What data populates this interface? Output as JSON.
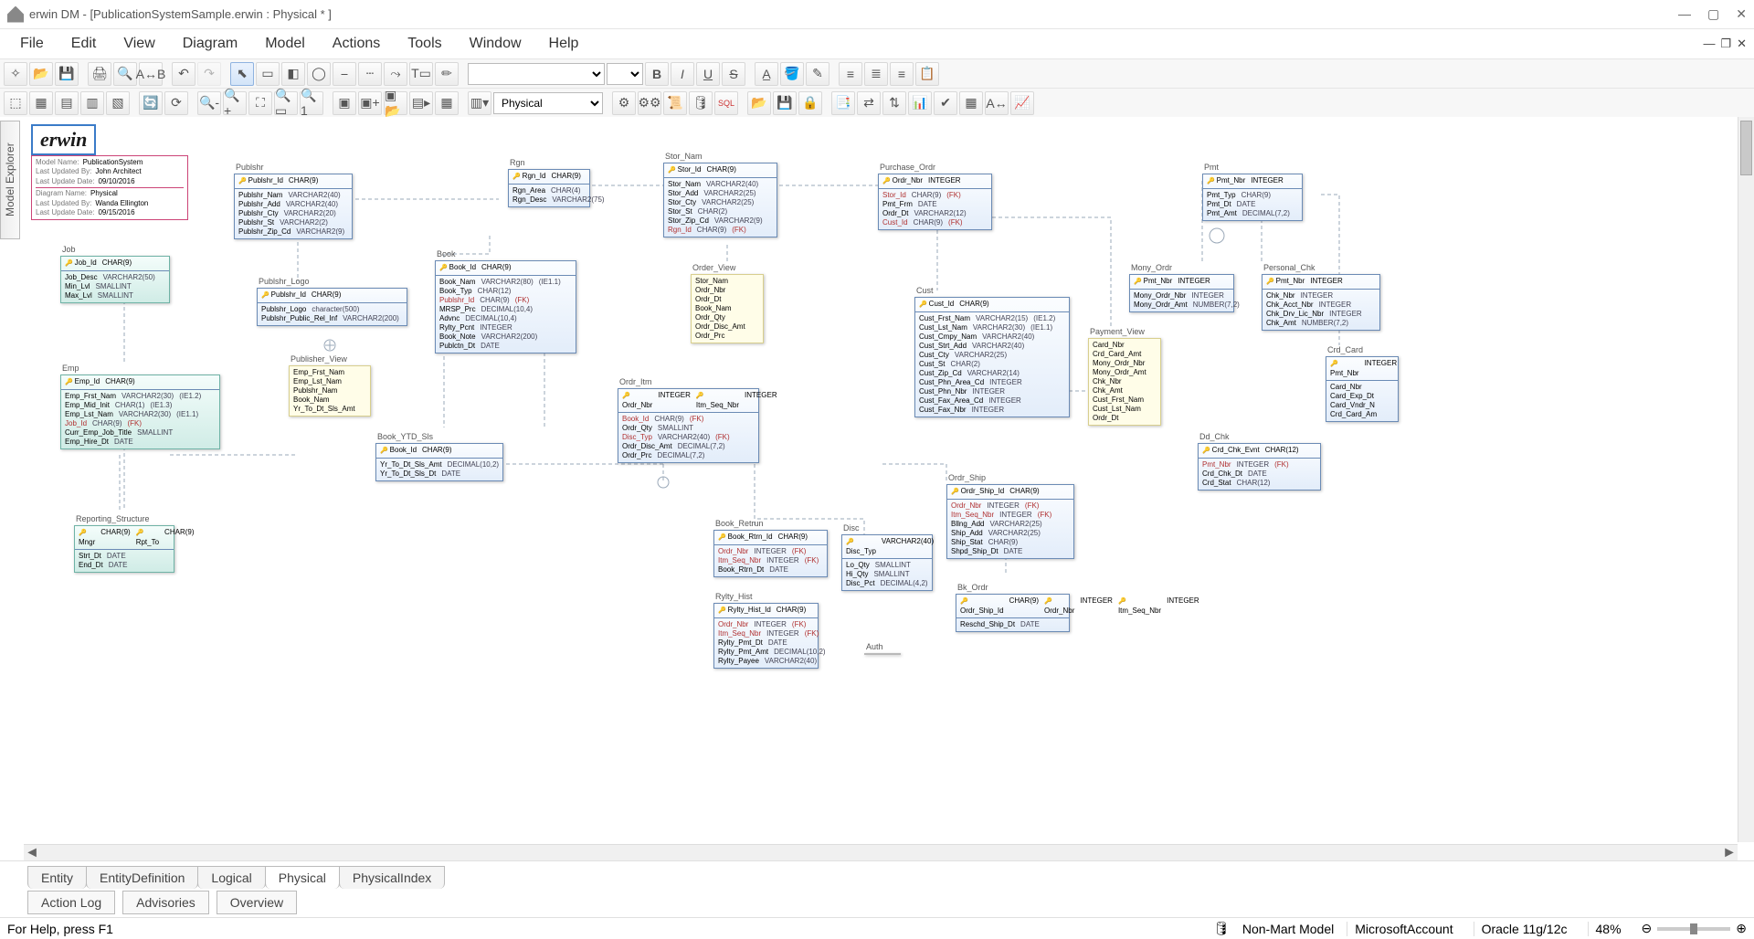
{
  "app_title": "erwin DM - [PublicationSystemSample.erwin : Physical * ]",
  "menus": [
    "File",
    "Edit",
    "View",
    "Diagram",
    "Model",
    "Actions",
    "Tools",
    "Window",
    "Help"
  ],
  "view_combo": "Physical",
  "side_panel": "Model Explorer",
  "diagram_tabs": [
    "Entity",
    "EntityDefinition",
    "Logical",
    "Physical",
    "PhysicalIndex"
  ],
  "active_diagram_tab": 3,
  "bottom_tabs": [
    "Action Log",
    "Advisories",
    "Overview"
  ],
  "status": {
    "help": "For Help, press F1",
    "mart": "Non-Mart Model",
    "account": "MicrosoftAccount",
    "db": "Oracle 11g/12c",
    "zoom": "48%"
  },
  "logo_text": "erwin",
  "meta_box": [
    [
      "Model Name:",
      "PublicationSystem"
    ],
    [
      "Last Updated By:",
      "John Architect"
    ],
    [
      "Last Update Date:",
      "09/10/2016"
    ],
    [
      "Diagram Name:",
      "Physical"
    ],
    [
      "Last Updated By:",
      "Wanda Ellington"
    ],
    [
      "Last Update Date:",
      "09/15/2016"
    ]
  ],
  "entities": {
    "Publshr": {
      "cap": "Publshr",
      "pk": [
        [
          "Publshr_Id",
          "CHAR(9)"
        ]
      ],
      "cols": [
        [
          "Publshr_Nam",
          "VARCHAR2(40)"
        ],
        [
          "Publshr_Add",
          "VARCHAR2(40)"
        ],
        [
          "Publshr_Cty",
          "VARCHAR2(20)"
        ],
        [
          "Publshr_St",
          "VARCHAR2(2)"
        ],
        [
          "Publshr_Zip_Cd",
          "VARCHAR2(9)"
        ]
      ]
    },
    "Rgn": {
      "cap": "Rgn",
      "pk": [
        [
          "Rgn_Id",
          "CHAR(9)"
        ]
      ],
      "cols": [
        [
          "Rgn_Area",
          "CHAR(4)"
        ],
        [
          "Rgn_Desc",
          "VARCHAR2(75)"
        ]
      ]
    },
    "Stor_Nam": {
      "cap": "Stor_Nam",
      "pk": [
        [
          "Stor_Id",
          "CHAR(9)"
        ]
      ],
      "cols": [
        [
          "Stor_Nam",
          "VARCHAR2(40)"
        ],
        [
          "Stor_Add",
          "VARCHAR2(25)"
        ],
        [
          "Stor_Cty",
          "VARCHAR2(25)"
        ],
        [
          "Stor_St",
          "CHAR(2)"
        ],
        [
          "Stor_Zip_Cd",
          "VARCHAR2(9)"
        ],
        [
          "Rgn_Id",
          "CHAR(9)",
          "fk"
        ]
      ]
    },
    "Purchase_Ordr": {
      "cap": "Purchase_Ordr",
      "pk": [
        [
          "Ordr_Nbr",
          "INTEGER"
        ]
      ],
      "cols": [
        [
          "Stor_Id",
          "CHAR(9)",
          "fk"
        ],
        [
          "Pmt_Frm",
          "DATE"
        ],
        [
          "Ordr_Dt",
          "VARCHAR2(12)"
        ],
        [
          "Cust_Id",
          "CHAR(9)",
          "fk"
        ]
      ]
    },
    "Pmt": {
      "cap": "Pmt",
      "pk": [
        [
          "Pmt_Nbr",
          "INTEGER"
        ]
      ],
      "cols": [
        [
          "Pmt_Typ",
          "CHAR(9)"
        ],
        [
          "Pmt_Dt",
          "DATE"
        ],
        [
          "Pmt_Amt",
          "DECIMAL(7,2)"
        ]
      ]
    },
    "Job": {
      "cap": "Job",
      "pk": [
        [
          "Job_Id",
          "CHAR(9)"
        ]
      ],
      "cols": [
        [
          "Job_Desc",
          "VARCHAR2(50)"
        ],
        [
          "Min_Lvl",
          "SMALLINT"
        ],
        [
          "Max_Lvl",
          "SMALLINT"
        ]
      ]
    },
    "Publshr_Logo": {
      "cap": "Publshr_Logo",
      "pk": [
        [
          "Publshr_Id",
          "CHAR(9)",
          "fk"
        ]
      ],
      "cols": [
        [
          "Publshr_Logo",
          "character(500)"
        ],
        [
          "Publshr_Public_Rel_Inf",
          "VARCHAR2(200)"
        ]
      ]
    },
    "Book": {
      "cap": "Book",
      "pk": [
        [
          "Book_Id",
          "CHAR(9)"
        ]
      ],
      "cols": [
        [
          "Book_Nam",
          "VARCHAR2(80)",
          "",
          "(IE1.1)"
        ],
        [
          "Book_Typ",
          "CHAR(12)"
        ],
        [
          "Publshr_Id",
          "CHAR(9)",
          "fk"
        ],
        [
          "MRSP_Prc",
          "DECIMAL(10,4)"
        ],
        [
          "Advnc",
          "DECIMAL(10,4)"
        ],
        [
          "Rylty_Pcnt",
          "INTEGER"
        ],
        [
          "Book_Note",
          "VARCHAR2(200)"
        ],
        [
          "Publctn_Dt",
          "DATE"
        ]
      ]
    },
    "Order_View": {
      "cap": "Order_View",
      "cols": [
        [
          "Stor_Nam"
        ],
        [
          "Ordr_Nbr"
        ],
        [
          "Ordr_Dt"
        ],
        [
          "Book_Nam"
        ],
        [
          "Ordr_Qty"
        ],
        [
          "Ordr_Disc_Amt"
        ],
        [
          "Ordr_Prc"
        ]
      ]
    },
    "Mony_Ordr": {
      "cap": "Mony_Ordr",
      "pk": [
        [
          "Pmt_Nbr",
          "INTEGER",
          "fk"
        ]
      ],
      "cols": [
        [
          "Mony_Ordr_Nbr",
          "INTEGER"
        ],
        [
          "Mony_Ordr_Amt",
          "NUMBER(7,2)"
        ]
      ]
    },
    "Personal_Chk": {
      "cap": "Personal_Chk",
      "pk": [
        [
          "Pmt_Nbr",
          "INTEGER",
          "fk"
        ]
      ],
      "cols": [
        [
          "Chk_Nbr",
          "INTEGER"
        ],
        [
          "Chk_Acct_Nbr",
          "INTEGER"
        ],
        [
          "Chk_Drv_Lic_Nbr",
          "INTEGER"
        ],
        [
          "Chk_Amt",
          "NUMBER(7,2)"
        ]
      ]
    },
    "Cust": {
      "cap": "Cust",
      "pk": [
        [
          "Cust_Id",
          "CHAR(9)"
        ]
      ],
      "cols": [
        [
          "Cust_Frst_Nam",
          "VARCHAR2(15)",
          "",
          "(IE1.2)"
        ],
        [
          "Cust_Lst_Nam",
          "VARCHAR2(30)",
          "",
          "(IE1.1)"
        ],
        [
          "Cust_Cmpy_Nam",
          "VARCHAR2(40)"
        ],
        [
          "Cust_Strt_Add",
          "VARCHAR2(40)"
        ],
        [
          "Cust_Cty",
          "VARCHAR2(25)"
        ],
        [
          "Cust_St",
          "CHAR(2)"
        ],
        [
          "Cust_Zip_Cd",
          "VARCHAR2(14)"
        ],
        [
          "Cust_Phn_Area_Cd",
          "INTEGER"
        ],
        [
          "Cust_Phn_Nbr",
          "INTEGER"
        ],
        [
          "Cust_Fax_Area_Cd",
          "INTEGER"
        ],
        [
          "Cust_Fax_Nbr",
          "INTEGER"
        ]
      ]
    },
    "Emp": {
      "cap": "Emp",
      "pk": [
        [
          "Emp_Id",
          "CHAR(9)"
        ]
      ],
      "cols": [
        [
          "Emp_Frst_Nam",
          "VARCHAR2(30)",
          "",
          "(IE1.2)"
        ],
        [
          "Emp_Mid_Init",
          "CHAR(1)",
          "",
          "(IE1.3)"
        ],
        [
          "Emp_Lst_Nam",
          "VARCHAR2(30)",
          "",
          "(IE1.1)"
        ],
        [
          "Job_Id",
          "CHAR(9)",
          "fk"
        ],
        [
          "Curr_Emp_Job_Title",
          "SMALLINT"
        ],
        [
          "Emp_Hire_Dt",
          "DATE"
        ]
      ]
    },
    "Publisher_View": {
      "cap": "Publisher_View",
      "cols": [
        [
          "Emp_Frst_Nam"
        ],
        [
          "Emp_Lst_Nam"
        ],
        [
          "Publshr_Nam"
        ],
        [
          "Book_Nam"
        ],
        [
          "Yr_To_Dt_Sls_Amt"
        ]
      ]
    },
    "Payment_View": {
      "cap": "Payment_View",
      "cols": [
        [
          "Card_Nbr"
        ],
        [
          "Crd_Card_Amt"
        ],
        [
          "Mony_Ordr_Nbr"
        ],
        [
          "Mony_Ordr_Amt"
        ],
        [
          "Chk_Nbr"
        ],
        [
          "Chk_Amt"
        ],
        [
          "Cust_Frst_Nam"
        ],
        [
          "Cust_Lst_Nam"
        ],
        [
          "Ordr_Dt"
        ]
      ]
    },
    "Book_YTD_Sls": {
      "cap": "Book_YTD_Sls",
      "pk": [
        [
          "Book_Id",
          "CHAR(9)",
          "fk"
        ]
      ],
      "cols": [
        [
          "Yr_To_Dt_Sls_Amt",
          "DECIMAL(10,2)"
        ],
        [
          "Yr_To_Dt_Sls_Dt",
          "DATE"
        ]
      ]
    },
    "Ordr_Itm": {
      "cap": "Ordr_Itm",
      "pk": [
        [
          "Ordr_Nbr",
          "INTEGER",
          "fk"
        ],
        [
          "Itm_Seq_Nbr",
          "INTEGER"
        ]
      ],
      "cols": [
        [
          "Book_Id",
          "CHAR(9)",
          "fk"
        ],
        [
          "Ordr_Qty",
          "SMALLINT"
        ],
        [
          "Disc_Typ",
          "VARCHAR2(40)",
          "fk"
        ],
        [
          "Ordr_Disc_Amt",
          "DECIMAL(7,2)"
        ],
        [
          "Ordr_Prc",
          "DECIMAL(7,2)"
        ]
      ]
    },
    "Ordr_Ship": {
      "cap": "Ordr_Ship",
      "pk": [
        [
          "Ordr_Ship_Id",
          "CHAR(9)"
        ]
      ],
      "cols": [
        [
          "Ordr_Nbr",
          "INTEGER",
          "fk"
        ],
        [
          "Itm_Seq_Nbr",
          "INTEGER",
          "fk"
        ],
        [
          "Bllng_Add",
          "VARCHAR2(25)"
        ],
        [
          "Ship_Add",
          "VARCHAR2(25)"
        ],
        [
          "Ship_Stat",
          "CHAR(9)"
        ],
        [
          "Shpd_Ship_Dt",
          "DATE"
        ]
      ]
    },
    "Reporting_Structure": {
      "cap": "Reporting_Structure",
      "pk": [
        [
          "Mngr",
          "CHAR(9)",
          "fk"
        ],
        [
          "Rpt_To",
          "CHAR(9)",
          "fk"
        ]
      ],
      "cols": [
        [
          "Strt_Dt",
          "DATE"
        ],
        [
          "End_Dt",
          "DATE"
        ]
      ]
    },
    "Book_Retrun": {
      "cap": "Book_Retrun",
      "pk": [
        [
          "Book_Rtrn_Id",
          "CHAR(9)"
        ]
      ],
      "cols": [
        [
          "Ordr_Nbr",
          "INTEGER",
          "fk"
        ],
        [
          "Itm_Seq_Nbr",
          "INTEGER",
          "fk"
        ],
        [
          "Book_Rtrn_Dt",
          "DATE"
        ]
      ]
    },
    "Disc": {
      "cap": "Disc",
      "pk": [
        [
          "Disc_Typ",
          "VARCHAR2(40)"
        ]
      ],
      "cols": [
        [
          "Lo_Qty",
          "SMALLINT"
        ],
        [
          "Hi_Qty",
          "SMALLINT"
        ],
        [
          "Disc_Pct",
          "DECIMAL(4,2)"
        ]
      ]
    },
    "Bk_Ordr": {
      "cap": "Bk_Ordr",
      "pk": [
        [
          "Ordr_Ship_Id",
          "CHAR(9)",
          "fk"
        ],
        [
          "Ordr_Nbr",
          "INTEGER",
          "fk"
        ],
        [
          "Itm_Seq_Nbr",
          "INTEGER",
          "fk"
        ]
      ],
      "cols": [
        [
          "Reschd_Ship_Dt",
          "DATE"
        ]
      ]
    },
    "Crd_Card": {
      "cap": "Crd_Card",
      "pk": [
        [
          "Pmt_Nbr",
          "INTEGER",
          "fk"
        ]
      ],
      "cols": [
        [
          "Card_Nbr"
        ],
        [
          "Card_Exp_Dt"
        ],
        [
          "Card_Vndr_N"
        ],
        [
          "Crd_Card_Am"
        ]
      ]
    },
    "Dd_Chk": {
      "cap": "Dd_Chk",
      "pk": [
        [
          "Crd_Chk_Evnt",
          "CHAR(12)"
        ]
      ],
      "cols": [
        [
          "Pmt_Nbr",
          "INTEGER",
          "fk"
        ],
        [
          "Crd_Chk_Dt",
          "DATE"
        ],
        [
          "Crd_Stat",
          "CHAR(12)"
        ]
      ]
    },
    "Rylty_Hist": {
      "cap": "Rylty_Hist",
      "pk": [
        [
          "Rylty_Hist_Id",
          "CHAR(9)"
        ]
      ],
      "cols": [
        [
          "Ordr_Nbr",
          "INTEGER",
          "fk"
        ],
        [
          "Itm_Seq_Nbr",
          "INTEGER",
          "fk"
        ],
        [
          "Rylty_Pmt_Dt",
          "DATE"
        ],
        [
          "Rylty_Pmt_Amt",
          "DECIMAL(10,2)"
        ],
        [
          "Rylty_Payee",
          "VARCHAR2(40)"
        ]
      ]
    },
    "Auth": {
      "cap": "Auth"
    }
  }
}
